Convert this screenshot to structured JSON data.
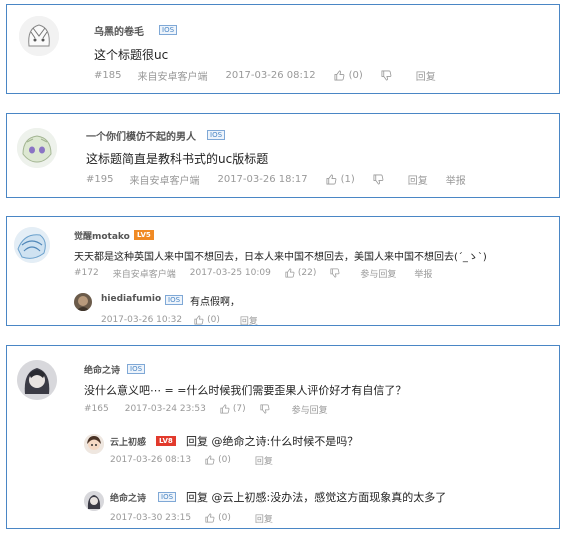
{
  "comments": [
    {
      "user": "乌黑的卷毛",
      "badge": "IOS",
      "text": "这个标题很uc",
      "floor": "#185",
      "source": "来自安卓客户端",
      "time": "2017-03-26 08:12",
      "likes": "(0)",
      "reply": "回复"
    },
    {
      "user": "一个你们模仿不起的男人",
      "badge": "IOS",
      "text": "这标题简直是教科书式的uc版标题",
      "floor": "#195",
      "source": "来自安卓客户端",
      "time": "2017-03-26 18:17",
      "likes": "(1)",
      "reply": "回复",
      "report": "举报"
    },
    {
      "user": "觉醒motako",
      "badge": "LV5",
      "text": "天天都是这种英国人来中国不想回去，日本人来中国不想回去，美国人来中国不想回去(´_ゝ`)",
      "floor": "#172",
      "source": "来自安卓客户端",
      "time": "2017-03-25 10:09",
      "likes": "(22)",
      "join": "参与回复",
      "report": "举报",
      "replies": [
        {
          "user": "hiediafumio",
          "badge": "IOS",
          "text": "有点假啊，",
          "time": "2017-03-26 10:32",
          "likes": "(0)",
          "reply": "回复"
        }
      ]
    },
    {
      "user": "绝命之诗",
      "badge": "IOS",
      "text": "没什么意义吧⋯ =  =什么时候我们需要歪果人评价好才有自信了？",
      "floor": "#165",
      "time": "2017-03-24 23:53",
      "likes": "(7)",
      "join": "参与回复",
      "replies": [
        {
          "user": "云上初感",
          "badge": "LV8",
          "text": "回复 @绝命之诗:什么时候不是吗？",
          "time": "2017-03-26 08:13",
          "likes": "(0)",
          "reply": "回复"
        },
        {
          "user": "绝命之诗",
          "badge": "IOS",
          "text": "回复 @云上初感:没办法，感觉这方面现象真的太多了",
          "time": "2017-03-30 23:15",
          "likes": "(0)",
          "reply": "回复"
        }
      ]
    }
  ]
}
